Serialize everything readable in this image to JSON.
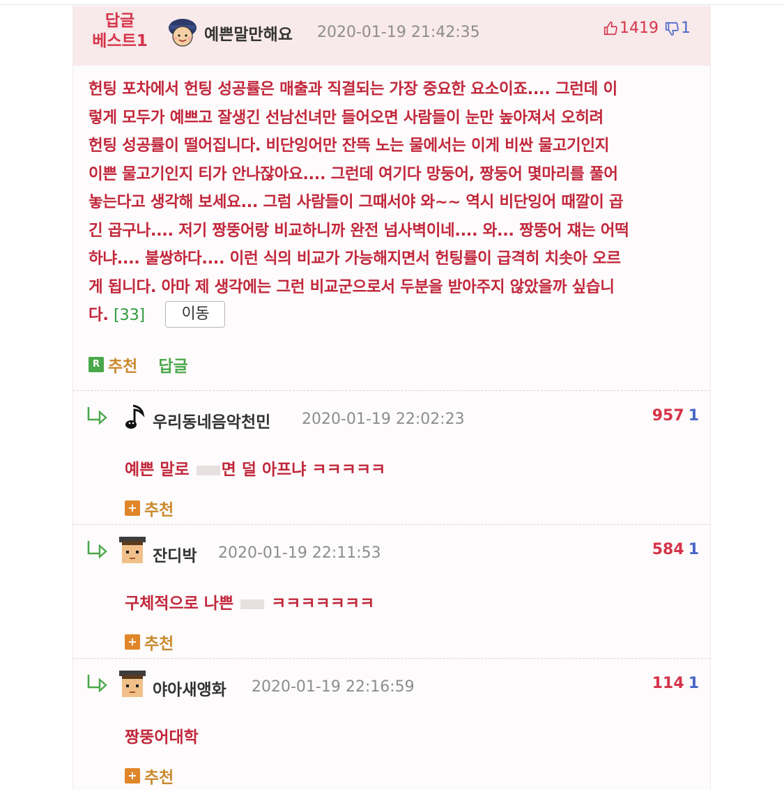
{
  "best": {
    "badge_line1": "답글",
    "badge_line2": "베스트1",
    "nickname": "예쁜말만해요",
    "datetime": "2020-01-19 21:42:35",
    "likes": "1419",
    "dislikes": "1",
    "body_lines": [
      "헌팅 포차에서 헌팅 성공률은 매출과 직결되는 가장 중요한 요소이죠.... 그런데 이",
      "렇게 모두가 예쁘고 잘생긴 선남선녀만 들어오면 사람들이 눈만 높아져서 오히려",
      "헌팅 성공률이 떨어집니다. 비단잉어만 잔뜩 노는 물에서는 이게 비싼 물고기인지",
      "이쁜 물고기인지 티가 안나잖아요.... 그런데 여기다 망둥어, 짱둥어 몇마리를 풀어",
      "놓는다고 생각해 보세요... 그럼 사람들이 그때서야 와~~ 역시 비단잉어 때깔이 곱",
      "긴 곱구나.... 저기 짱뚱어랑 비교하니까 완전 넘사벽이네.... 와... 짱뚱어 쟤는 어떡",
      "하냐.... 불쌍하다.... 이런 식의 비교가 가능해지면서 헌팅률이 급격히 치솟아 오르",
      "게 됩니다. 아마 제 생각에는 그런 비교군으로서 두분을 받아주지 않았을까 싶습니"
    ],
    "last_line": "다.",
    "ref_count": "[33]",
    "move_label": "이동",
    "recommend_label": "추천",
    "reply_label": "답글",
    "reply_box": "R"
  },
  "replies": [
    {
      "nickname": "우리동네음악천민",
      "datetime": "2020-01-19 22:02:23",
      "likes": "957",
      "dislikes": "1",
      "text_before": "예쁜 말로 ",
      "text_after": "면 덜 아프냐 ㅋㅋㅋㅋㅋ",
      "recommend_label": "추천"
    },
    {
      "nickname": "잔디박",
      "datetime": "2020-01-19 22:11:53",
      "likes": "584",
      "dislikes": "1",
      "text_before": "구체적으로 나쁜 ",
      "text_after": " ㅋㅋㅋㅋㅋㅋㅋ",
      "recommend_label": "추천"
    },
    {
      "nickname": "야아새앵화",
      "datetime": "2020-01-19 22:16:59",
      "likes": "114",
      "dislikes": "1",
      "text_before": "짱뚱어대학",
      "text_after": "",
      "recommend_label": "추천"
    }
  ],
  "colors": {
    "accent_red": "#d5344a",
    "body_red": "#c1273b",
    "recommend_orange": "#e0862a",
    "reply_green": "#4aa84a"
  },
  "icons": [
    "thumbs-up-icon",
    "thumbs-down-icon",
    "reply-arrow-icon",
    "plus-icon",
    "reply-r-icon",
    "music-note-icon",
    "avatar-icon"
  ]
}
